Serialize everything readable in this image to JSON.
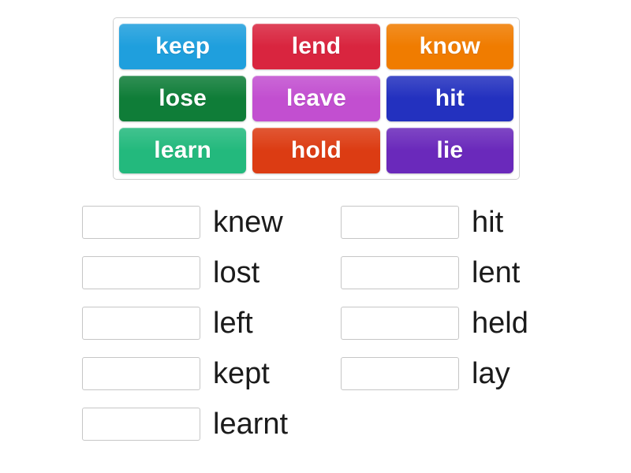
{
  "activity": {
    "type": "match-up",
    "tile_bank": {
      "rows": 3,
      "columns": 3,
      "tiles": [
        {
          "label": "keep",
          "color": "#1f9fdd"
        },
        {
          "label": "lend",
          "color": "#d9253f"
        },
        {
          "label": "know",
          "color": "#f07c00"
        },
        {
          "label": "lose",
          "color": "#0f7d38"
        },
        {
          "label": "leave",
          "color": "#c24fd0"
        },
        {
          "label": "hit",
          "color": "#2331bf"
        },
        {
          "label": "learn",
          "color": "#23b97d"
        },
        {
          "label": "hold",
          "color": "#dc3c13"
        },
        {
          "label": "lie",
          "color": "#6a29bb"
        }
      ]
    },
    "answer_columns": [
      {
        "column": "left",
        "rows": [
          {
            "drop_label": "",
            "answer": "knew"
          },
          {
            "drop_label": "",
            "answer": "lost"
          },
          {
            "drop_label": "",
            "answer": "left"
          },
          {
            "drop_label": "",
            "answer": "kept"
          },
          {
            "drop_label": "",
            "answer": "learnt"
          }
        ]
      },
      {
        "column": "right",
        "rows": [
          {
            "drop_label": "",
            "answer": "hit"
          },
          {
            "drop_label": "",
            "answer": "lent"
          },
          {
            "drop_label": "",
            "answer": "held"
          },
          {
            "drop_label": "",
            "answer": "lay"
          }
        ]
      }
    ]
  },
  "colors": {
    "page_background": "#ffffff",
    "bank_border": "#cfcfcf",
    "drop_zone_border": "#c6c6c6",
    "answer_text": "#1b1b1b",
    "tile_text": "#ffffff"
  }
}
